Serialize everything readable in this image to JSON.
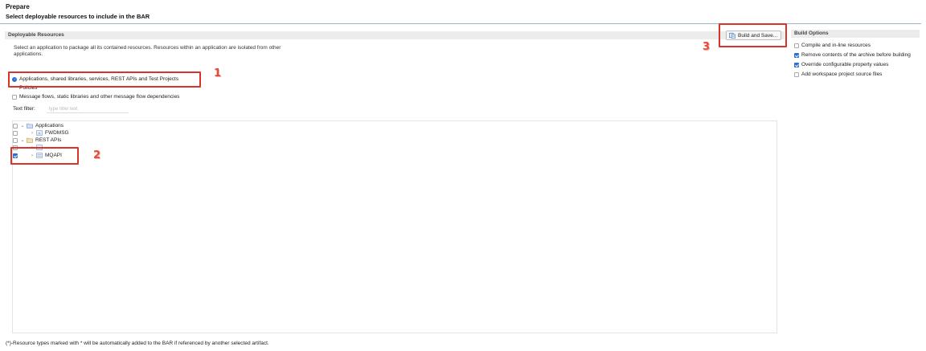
{
  "header": {
    "title": "Prepare",
    "subtitle": "Select deployable resources to include in the BAR"
  },
  "deployable": {
    "section_title": "Deployable Resources",
    "description": "Select an application to package all its contained resources. Resources within an application are isolated from other applications.",
    "radio_options": [
      {
        "label": "Applications, shared libraries, services, REST APIs and Test Projects",
        "selected": true
      },
      {
        "label": "Policies",
        "selected": false
      }
    ],
    "message_flows_label": "Message flows, static libraries and other message flow dependencies",
    "filter_label": "Text filter:",
    "filter_placeholder": "type filter text",
    "tree": [
      {
        "label": "Applications",
        "expanded": true,
        "checked": false,
        "level": 0
      },
      {
        "label": "FWDMSG",
        "expanded": false,
        "checked": false,
        "level": 1
      },
      {
        "label": "REST APIs",
        "expanded": true,
        "checked": false,
        "level": 0
      },
      {
        "label": "...",
        "expanded": false,
        "checked": false,
        "level": 1
      },
      {
        "label": "MQAPI",
        "expanded": false,
        "checked": true,
        "level": 1
      }
    ],
    "build_button_label": "Build and Save..."
  },
  "build_options": {
    "section_title": "Build Options",
    "items": [
      {
        "label": "Compile and in-line resources",
        "checked": false
      },
      {
        "label": "Remove contents of the archive before building",
        "checked": true
      },
      {
        "label": "Override configurable property values",
        "checked": true
      },
      {
        "label": "Add workspace project source files",
        "checked": false
      }
    ]
  },
  "callouts": [
    "1",
    "2",
    "3"
  ],
  "footer": "(*)-Resource types marked with * will be automatically added to the BAR if referenced by another selected artifact.",
  "colors": {
    "accent": "#2f6fd1",
    "callout": "#d9342b",
    "rule": "#9fb6cf"
  }
}
